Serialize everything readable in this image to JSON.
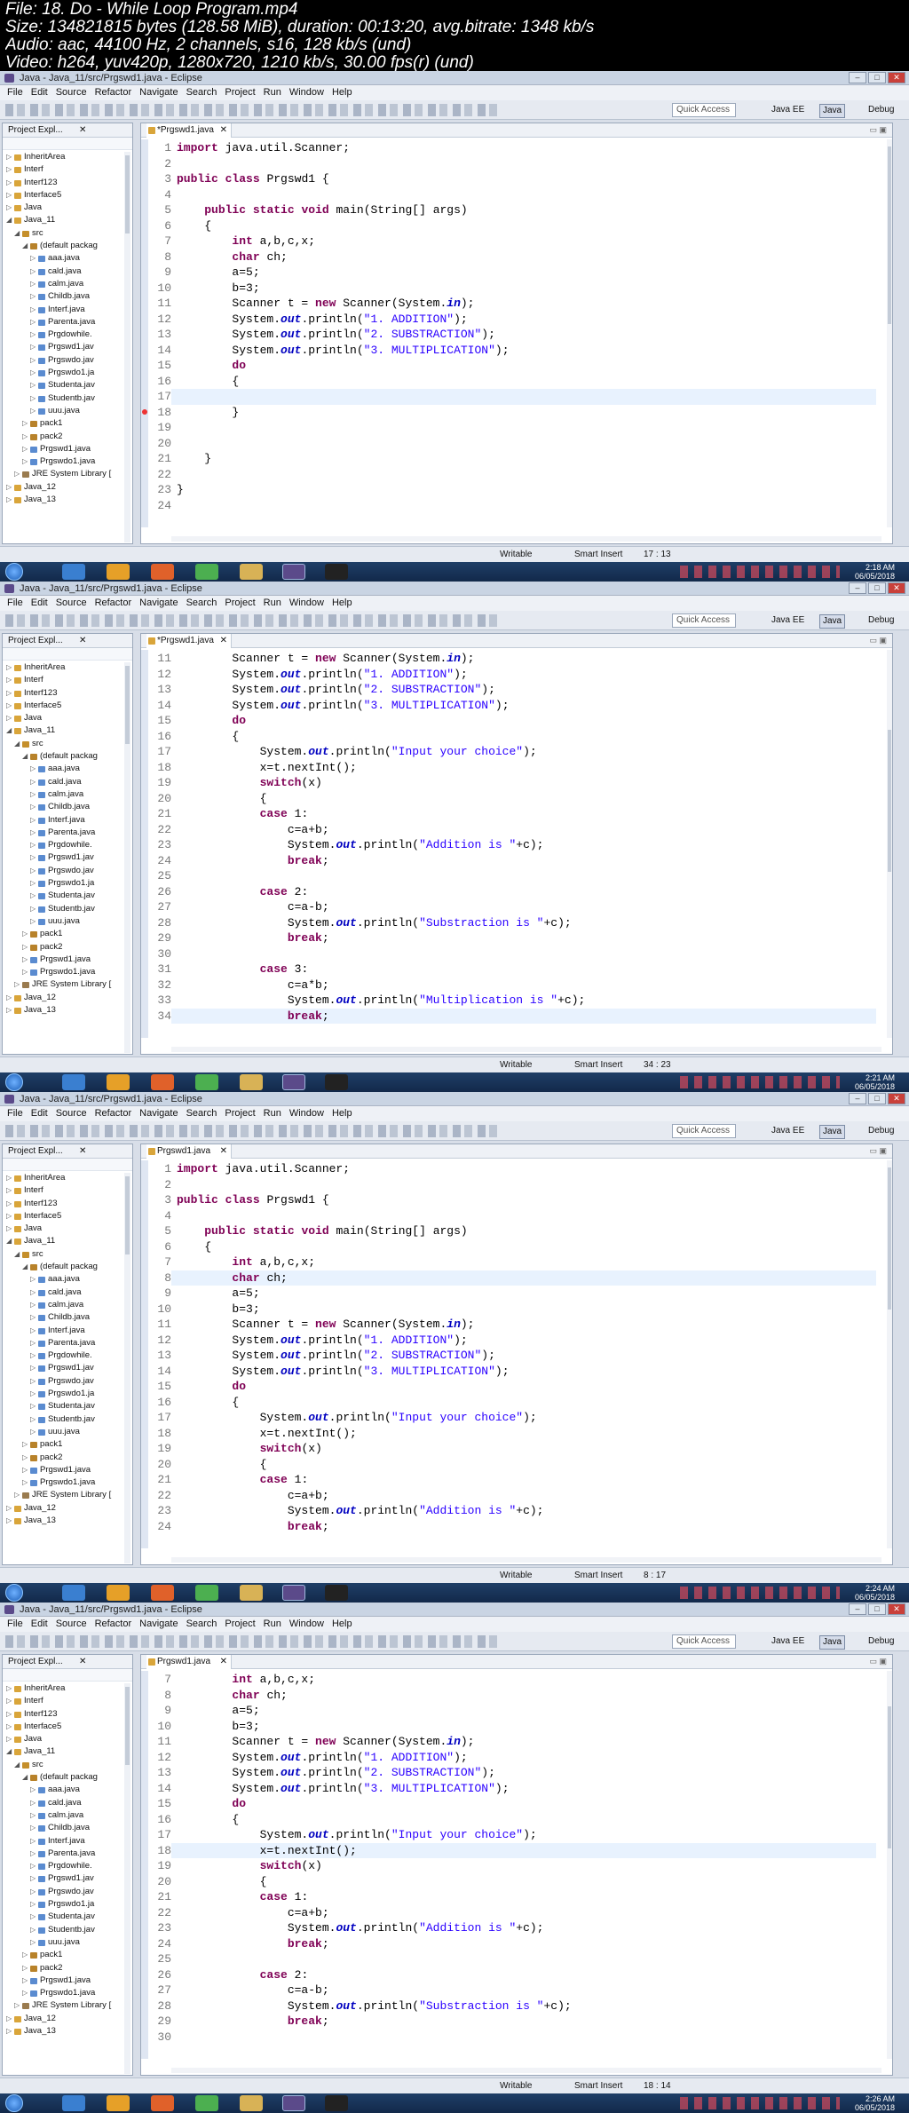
{
  "file_info": [
    "File: 18. Do - While Loop Program.mp4",
    "Size: 134821815 bytes (128.58 MiB), duration: 00:13:20, avg.bitrate: 1348 kb/s",
    "Audio: aac, 44100 Hz, 2 channels, s16, 128 kb/s (und)",
    "Video: h264, yuv420p, 1280x720, 1210 kb/s, 30.00 fps(r) (und)"
  ],
  "frames": [
    {
      "title": "Java - Java_11/src/Prgswd1.java - Eclipse",
      "tab": "*Prgswd1.java",
      "status_mode": "Writable",
      "status_insert": "Smart Insert",
      "cursor_pos": "17 : 13",
      "clock_time": "2:18 AM",
      "clock_date": "06/05/2018",
      "lines": [
        {
          "n": "1",
          "c": "import java.util.Scanner;"
        },
        {
          "n": "2",
          "c": ""
        },
        {
          "n": "3",
          "c": "public class Prgswd1 {"
        },
        {
          "n": "4",
          "c": ""
        },
        {
          "n": "5",
          "c": "    public static void main(String[] args)"
        },
        {
          "n": "6",
          "c": "    {"
        },
        {
          "n": "7",
          "c": "        int a,b,c,x;"
        },
        {
          "n": "8",
          "c": "        char ch;"
        },
        {
          "n": "9",
          "c": "        a=5;"
        },
        {
          "n": "10",
          "c": "        b=3;"
        },
        {
          "n": "11",
          "c": "        Scanner t = new Scanner(System.in);"
        },
        {
          "n": "12",
          "c": "        System.out.println(\"1. ADDITION\");"
        },
        {
          "n": "13",
          "c": "        System.out.println(\"2. SUBSTRACTION\");"
        },
        {
          "n": "14",
          "c": "        System.out.println(\"3. MULTIPLICATION\");"
        },
        {
          "n": "15",
          "c": "        do"
        },
        {
          "n": "16",
          "c": "        {"
        },
        {
          "n": "17",
          "c": ""
        },
        {
          "n": "18",
          "c": "        }"
        },
        {
          "n": "19",
          "c": ""
        },
        {
          "n": "20",
          "c": ""
        },
        {
          "n": "21",
          "c": "    }"
        },
        {
          "n": "22",
          "c": ""
        },
        {
          "n": "23",
          "c": "}"
        },
        {
          "n": "24",
          "c": ""
        }
      ]
    },
    {
      "title": "Java - Java_11/src/Prgswd1.java - Eclipse",
      "tab": "*Prgswd1.java",
      "status_mode": "Writable",
      "status_insert": "Smart Insert",
      "cursor_pos": "34 : 23",
      "clock_time": "2:21 AM",
      "clock_date": "06/05/2018",
      "lines": [
        {
          "n": "11",
          "c": "        Scanner t = new Scanner(System.in);"
        },
        {
          "n": "12",
          "c": "        System.out.println(\"1. ADDITION\");"
        },
        {
          "n": "13",
          "c": "        System.out.println(\"2. SUBSTRACTION\");"
        },
        {
          "n": "14",
          "c": "        System.out.println(\"3. MULTIPLICATION\");"
        },
        {
          "n": "15",
          "c": "        do"
        },
        {
          "n": "16",
          "c": "        {"
        },
        {
          "n": "17",
          "c": "            System.out.println(\"Input your choice\");"
        },
        {
          "n": "18",
          "c": "            x=t.nextInt();"
        },
        {
          "n": "19",
          "c": "            switch(x)"
        },
        {
          "n": "20",
          "c": "            {"
        },
        {
          "n": "21",
          "c": "            case 1:"
        },
        {
          "n": "22",
          "c": "                c=a+b;"
        },
        {
          "n": "23",
          "c": "                System.out.println(\"Addition is \"+c);"
        },
        {
          "n": "24",
          "c": "                break;"
        },
        {
          "n": "25",
          "c": ""
        },
        {
          "n": "26",
          "c": "            case 2:"
        },
        {
          "n": "27",
          "c": "                c=a-b;"
        },
        {
          "n": "28",
          "c": "                System.out.println(\"Substraction is \"+c);"
        },
        {
          "n": "29",
          "c": "                break;"
        },
        {
          "n": "30",
          "c": ""
        },
        {
          "n": "31",
          "c": "            case 3:"
        },
        {
          "n": "32",
          "c": "                c=a*b;"
        },
        {
          "n": "33",
          "c": "                System.out.println(\"Multiplication is \"+c);"
        },
        {
          "n": "34",
          "c": "                break;"
        }
      ]
    },
    {
      "title": "Java - Java_11/src/Prgswd1.java - Eclipse",
      "tab": "Prgswd1.java",
      "status_mode": "Writable",
      "status_insert": "Smart Insert",
      "cursor_pos": "8 : 17",
      "clock_time": "2:24 AM",
      "clock_date": "06/05/2018",
      "lines": [
        {
          "n": "1",
          "c": "import java.util.Scanner;"
        },
        {
          "n": "2",
          "c": ""
        },
        {
          "n": "3",
          "c": "public class Prgswd1 {"
        },
        {
          "n": "4",
          "c": ""
        },
        {
          "n": "5",
          "c": "    public static void main(String[] args)"
        },
        {
          "n": "6",
          "c": "    {"
        },
        {
          "n": "7",
          "c": "        int a,b,c,x;"
        },
        {
          "n": "8",
          "c": "        char ch;"
        },
        {
          "n": "9",
          "c": "        a=5;"
        },
        {
          "n": "10",
          "c": "        b=3;"
        },
        {
          "n": "11",
          "c": "        Scanner t = new Scanner(System.in);"
        },
        {
          "n": "12",
          "c": "        System.out.println(\"1. ADDITION\");"
        },
        {
          "n": "13",
          "c": "        System.out.println(\"2. SUBSTRACTION\");"
        },
        {
          "n": "14",
          "c": "        System.out.println(\"3. MULTIPLICATION\");"
        },
        {
          "n": "15",
          "c": "        do"
        },
        {
          "n": "16",
          "c": "        {"
        },
        {
          "n": "17",
          "c": "            System.out.println(\"Input your choice\");"
        },
        {
          "n": "18",
          "c": "            x=t.nextInt();"
        },
        {
          "n": "19",
          "c": "            switch(x)"
        },
        {
          "n": "20",
          "c": "            {"
        },
        {
          "n": "21",
          "c": "            case 1:"
        },
        {
          "n": "22",
          "c": "                c=a+b;"
        },
        {
          "n": "23",
          "c": "                System.out.println(\"Addition is \"+c);"
        },
        {
          "n": "24",
          "c": "                break;"
        }
      ]
    },
    {
      "title": "Java - Java_11/src/Prgswd1.java - Eclipse",
      "tab": "Prgswd1.java",
      "status_mode": "Writable",
      "status_insert": "Smart Insert",
      "cursor_pos": "18 : 14",
      "clock_time": "2:26 AM",
      "clock_date": "06/05/2018",
      "lines": [
        {
          "n": "7",
          "c": "        int a,b,c,x;"
        },
        {
          "n": "8",
          "c": "        char ch;"
        },
        {
          "n": "9",
          "c": "        a=5;"
        },
        {
          "n": "10",
          "c": "        b=3;"
        },
        {
          "n": "11",
          "c": "        Scanner t = new Scanner(System.in);"
        },
        {
          "n": "12",
          "c": "        System.out.println(\"1. ADDITION\");"
        },
        {
          "n": "13",
          "c": "        System.out.println(\"2. SUBSTRACTION\");"
        },
        {
          "n": "14",
          "c": "        System.out.println(\"3. MULTIPLICATION\");"
        },
        {
          "n": "15",
          "c": "        do"
        },
        {
          "n": "16",
          "c": "        {"
        },
        {
          "n": "17",
          "c": "            System.out.println(\"Input your choice\");"
        },
        {
          "n": "18",
          "c": "            x=t.nextInt();"
        },
        {
          "n": "19",
          "c": "            switch(x)"
        },
        {
          "n": "20",
          "c": "            {"
        },
        {
          "n": "21",
          "c": "            case 1:"
        },
        {
          "n": "22",
          "c": "                c=a+b;"
        },
        {
          "n": "23",
          "c": "                System.out.println(\"Addition is \"+c);"
        },
        {
          "n": "24",
          "c": "                break;"
        },
        {
          "n": "25",
          "c": ""
        },
        {
          "n": "26",
          "c": "            case 2:"
        },
        {
          "n": "27",
          "c": "                c=a-b;"
        },
        {
          "n": "28",
          "c": "                System.out.println(\"Substraction is \"+c);"
        },
        {
          "n": "29",
          "c": "                break;"
        },
        {
          "n": "30",
          "c": ""
        }
      ]
    }
  ],
  "menu": [
    "File",
    "Edit",
    "Source",
    "Refactor",
    "Navigate",
    "Search",
    "Project",
    "Run",
    "Window",
    "Help"
  ],
  "quick_access": "Quick Access",
  "perspectives": [
    "Java EE",
    "Java",
    "Debug"
  ],
  "explorer_title": "Project Expl...",
  "tree": [
    {
      "d": 0,
      "t": "InheritArea",
      "k": "proj"
    },
    {
      "d": 0,
      "t": "Interf",
      "k": "proj"
    },
    {
      "d": 0,
      "t": "Interf123",
      "k": "proj"
    },
    {
      "d": 0,
      "t": "Interface5",
      "k": "proj"
    },
    {
      "d": 0,
      "t": "Java",
      "k": "proj"
    },
    {
      "d": 0,
      "t": "Java_11",
      "k": "proj",
      "open": true
    },
    {
      "d": 1,
      "t": "src",
      "k": "src",
      "open": true
    },
    {
      "d": 2,
      "t": "(default packag",
      "k": "pkg",
      "open": true
    },
    {
      "d": 3,
      "t": "aaa.java",
      "k": "java"
    },
    {
      "d": 3,
      "t": "cald.java",
      "k": "java"
    },
    {
      "d": 3,
      "t": "calm.java",
      "k": "java"
    },
    {
      "d": 3,
      "t": "Childb.java",
      "k": "java"
    },
    {
      "d": 3,
      "t": "Interf.java",
      "k": "java"
    },
    {
      "d": 3,
      "t": "Parenta.java",
      "k": "java"
    },
    {
      "d": 3,
      "t": "Prgdowhile.",
      "k": "java"
    },
    {
      "d": 3,
      "t": "Prgswd1.jav",
      "k": "java"
    },
    {
      "d": 3,
      "t": "Prgswdo.jav",
      "k": "java"
    },
    {
      "d": 3,
      "t": "Prgswdo1.ja",
      "k": "java"
    },
    {
      "d": 3,
      "t": "Studenta.jav",
      "k": "java"
    },
    {
      "d": 3,
      "t": "Studentb.jav",
      "k": "java"
    },
    {
      "d": 3,
      "t": "uuu.java",
      "k": "java"
    },
    {
      "d": 2,
      "t": "pack1",
      "k": "pkg"
    },
    {
      "d": 2,
      "t": "pack2",
      "k": "pkg"
    },
    {
      "d": 2,
      "t": "Prgswd1.java",
      "k": "java"
    },
    {
      "d": 2,
      "t": "Prgswdo1.java",
      "k": "java"
    },
    {
      "d": 1,
      "t": "JRE System Library [",
      "k": "lib"
    },
    {
      "d": 0,
      "t": "Java_12",
      "k": "proj"
    },
    {
      "d": 0,
      "t": "Java_13",
      "k": "proj"
    }
  ],
  "colors": {
    "keyword": "#7f0055",
    "string": "#2a00ff",
    "field": "#0000c0"
  }
}
